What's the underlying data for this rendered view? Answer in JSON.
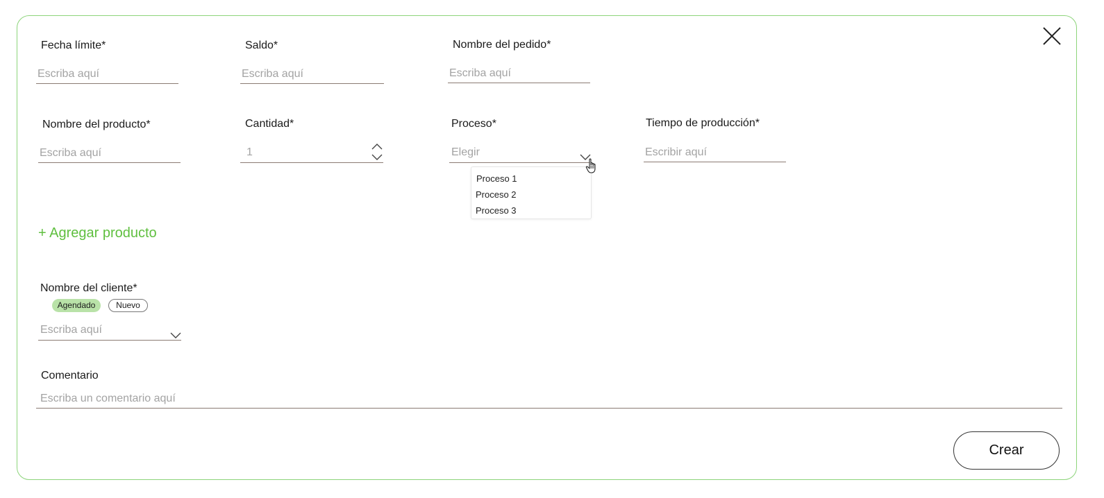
{
  "form": {
    "fecha_limite": {
      "label": "Fecha límite*",
      "placeholder": "Escriba aquí"
    },
    "saldo": {
      "label": "Saldo*",
      "placeholder": "Escriba aquí"
    },
    "nombre_pedido": {
      "label": "Nombre del pedido*",
      "placeholder": "Escriba aquí"
    },
    "nombre_producto": {
      "label": "Nombre del producto*",
      "placeholder": "Escriba aquí"
    },
    "cantidad": {
      "label": "Cantidad*",
      "value": "1"
    },
    "proceso": {
      "label": "Proceso*",
      "placeholder": "Elegir",
      "options": [
        "Proceso 1",
        "Proceso 2",
        "Proceso 3"
      ]
    },
    "tiempo_produccion": {
      "label": "Tiempo de producción*",
      "placeholder": "Escribir aquí"
    },
    "add_product_label": "+ Agregar producto",
    "cliente": {
      "label": "Nombre del cliente*",
      "chips": [
        "Agendado",
        "Nuevo"
      ],
      "placeholder": "Escriba aquí"
    },
    "comentario": {
      "label": "Comentario",
      "placeholder": "Escriba un comentario aquí"
    },
    "submit_label": "Crear"
  },
  "colors": {
    "accent": "#5fbf3f",
    "border": "#8cd47a",
    "chip_selected": "#b9e2a8",
    "underline": "#8a7a72",
    "placeholder": "#a3a3a3"
  },
  "icons": [
    "close-icon",
    "chevron-up-icon",
    "chevron-down-icon",
    "hand-pointer-cursor-icon"
  ]
}
